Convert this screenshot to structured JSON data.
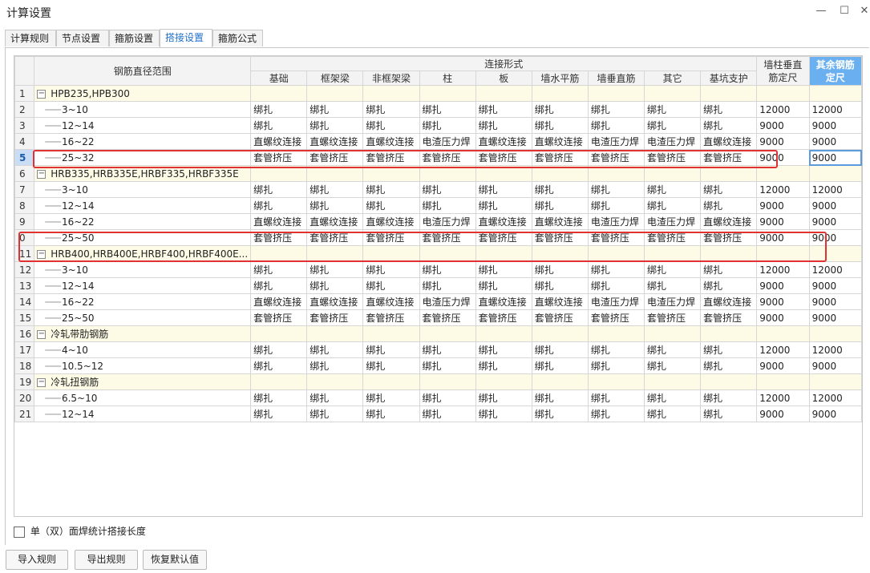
{
  "window": {
    "title": "计算设置",
    "minimize": "—",
    "maximize": "☐",
    "close": "✕"
  },
  "tabs": [
    "计算规则",
    "节点设置",
    "箍筋设置",
    "搭接设置",
    "箍筋公式"
  ],
  "active_tab": "搭接设置",
  "table": {
    "header_diameter": "钢筋直径范围",
    "header_connection": "连接形式",
    "connection_columns": [
      "基础",
      "框架梁",
      "非框架梁",
      "柱",
      "板",
      "墙水平筋",
      "墙垂直筋",
      "其它",
      "基坑支护"
    ],
    "header_wall_vertical": "墙柱垂直筋定尺",
    "header_other_fixed": "其余钢筋定尺",
    "rows": [
      {
        "n": "1",
        "group": true,
        "label": "HPB235,HPB300"
      },
      {
        "n": "2",
        "label": "3~10",
        "cells": [
          "绑扎",
          "绑扎",
          "绑扎",
          "绑扎",
          "绑扎",
          "绑扎",
          "绑扎",
          "绑扎",
          "绑扎",
          "12000",
          "12000"
        ]
      },
      {
        "n": "3",
        "label": "12~14",
        "cells": [
          "绑扎",
          "绑扎",
          "绑扎",
          "绑扎",
          "绑扎",
          "绑扎",
          "绑扎",
          "绑扎",
          "绑扎",
          "9000",
          "9000"
        ]
      },
      {
        "n": "4",
        "label": "16~22",
        "cells": [
          "直螺纹连接",
          "直螺纹连接",
          "直螺纹连接",
          "电渣压力焊",
          "直螺纹连接",
          "直螺纹连接",
          "电渣压力焊",
          "电渣压力焊",
          "直螺纹连接",
          "9000",
          "9000"
        ]
      },
      {
        "n": "5",
        "label": "25~32",
        "selected": true,
        "cells": [
          "套管挤压",
          "套管挤压",
          "套管挤压",
          "套管挤压",
          "套管挤压",
          "套管挤压",
          "套管挤压",
          "套管挤压",
          "套管挤压",
          "9000",
          "9000"
        ]
      },
      {
        "n": "6",
        "group": true,
        "label": "HRB335,HRB335E,HRBF335,HRBF335E"
      },
      {
        "n": "7",
        "label": "3~10",
        "cells": [
          "绑扎",
          "绑扎",
          "绑扎",
          "绑扎",
          "绑扎",
          "绑扎",
          "绑扎",
          "绑扎",
          "绑扎",
          "12000",
          "12000"
        ]
      },
      {
        "n": "8",
        "label": "12~14",
        "cells": [
          "绑扎",
          "绑扎",
          "绑扎",
          "绑扎",
          "绑扎",
          "绑扎",
          "绑扎",
          "绑扎",
          "绑扎",
          "9000",
          "9000"
        ]
      },
      {
        "n": "9",
        "label": "16~22",
        "cells": [
          "直螺纹连接",
          "直螺纹连接",
          "直螺纹连接",
          "电渣压力焊",
          "直螺纹连接",
          "直螺纹连接",
          "电渣压力焊",
          "电渣压力焊",
          "直螺纹连接",
          "9000",
          "9000"
        ]
      },
      {
        "n": "0",
        "label": "25~50",
        "cells": [
          "套管挤压",
          "套管挤压",
          "套管挤压",
          "套管挤压",
          "套管挤压",
          "套管挤压",
          "套管挤压",
          "套管挤压",
          "套管挤压",
          "9000",
          "9000"
        ]
      },
      {
        "n": "11",
        "group": true,
        "label": "HRB400,HRB400E,HRBF400,HRBF400E..."
      },
      {
        "n": "12",
        "label": "3~10",
        "cells": [
          "绑扎",
          "绑扎",
          "绑扎",
          "绑扎",
          "绑扎",
          "绑扎",
          "绑扎",
          "绑扎",
          "绑扎",
          "12000",
          "12000"
        ]
      },
      {
        "n": "13",
        "label": "12~14",
        "cells": [
          "绑扎",
          "绑扎",
          "绑扎",
          "绑扎",
          "绑扎",
          "绑扎",
          "绑扎",
          "绑扎",
          "绑扎",
          "9000",
          "9000"
        ]
      },
      {
        "n": "14",
        "label": "16~22",
        "cells": [
          "直螺纹连接",
          "直螺纹连接",
          "直螺纹连接",
          "电渣压力焊",
          "直螺纹连接",
          "直螺纹连接",
          "电渣压力焊",
          "电渣压力焊",
          "直螺纹连接",
          "9000",
          "9000"
        ]
      },
      {
        "n": "15",
        "label": "25~50",
        "cells": [
          "套管挤压",
          "套管挤压",
          "套管挤压",
          "套管挤压",
          "套管挤压",
          "套管挤压",
          "套管挤压",
          "套管挤压",
          "套管挤压",
          "9000",
          "9000"
        ]
      },
      {
        "n": "16",
        "group": true,
        "label": "冷轧带肋钢筋"
      },
      {
        "n": "17",
        "label": "4~10",
        "cells": [
          "绑扎",
          "绑扎",
          "绑扎",
          "绑扎",
          "绑扎",
          "绑扎",
          "绑扎",
          "绑扎",
          "绑扎",
          "12000",
          "12000"
        ]
      },
      {
        "n": "18",
        "label": "10.5~12",
        "cells": [
          "绑扎",
          "绑扎",
          "绑扎",
          "绑扎",
          "绑扎",
          "绑扎",
          "绑扎",
          "绑扎",
          "绑扎",
          "9000",
          "9000"
        ]
      },
      {
        "n": "19",
        "group": true,
        "label": "冷轧扭钢筋"
      },
      {
        "n": "20",
        "label": "6.5~10",
        "cells": [
          "绑扎",
          "绑扎",
          "绑扎",
          "绑扎",
          "绑扎",
          "绑扎",
          "绑扎",
          "绑扎",
          "绑扎",
          "12000",
          "12000"
        ]
      },
      {
        "n": "21",
        "label": "12~14",
        "cells": [
          "绑扎",
          "绑扎",
          "绑扎",
          "绑扎",
          "绑扎",
          "绑扎",
          "绑扎",
          "绑扎",
          "绑扎",
          "9000",
          "9000"
        ]
      }
    ]
  },
  "checkbox_label": "单（双）面焊统计搭接长度",
  "buttons": {
    "import": "导入规则",
    "export": "导出规则",
    "restore": "恢复默认值"
  },
  "colors": {
    "accent": "#1f6fc9",
    "highlight_header": "#6ab0f1",
    "annotation": "#e03232",
    "group_row": "#fdfbe6"
  }
}
